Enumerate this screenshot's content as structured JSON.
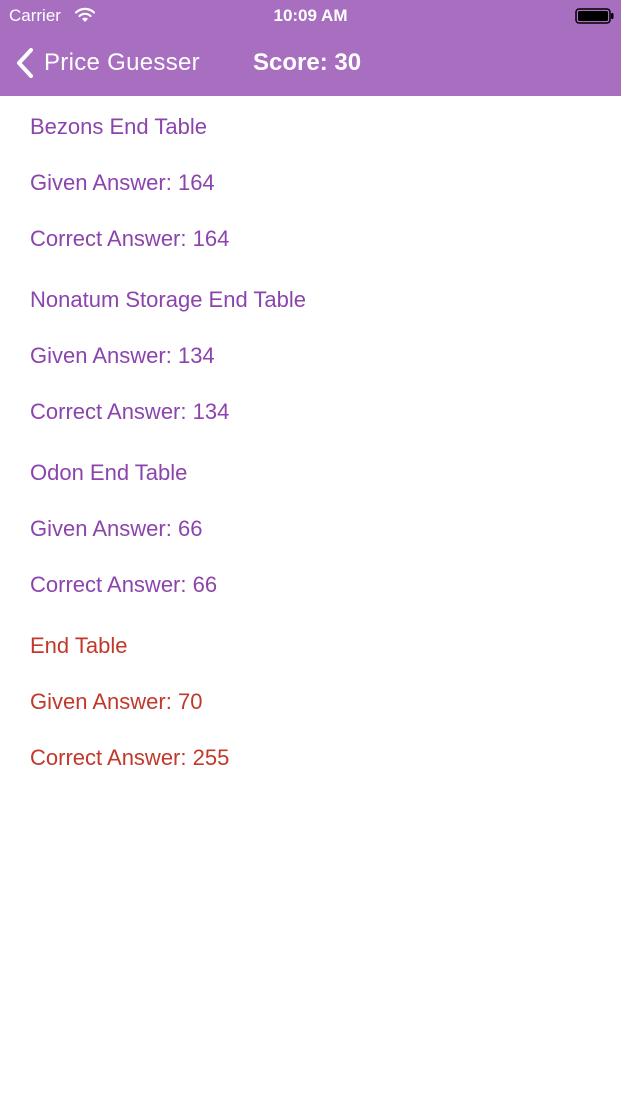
{
  "status_bar": {
    "carrier": "Carrier",
    "time": "10:09 AM",
    "wifi_icon": "wifi-icon",
    "battery_icon": "battery-icon"
  },
  "nav": {
    "back_label": "Price Guesser",
    "back_icon": "chevron-left-icon",
    "title": "Score: 30"
  },
  "colors": {
    "nav_background": "#a86fc0",
    "correct_text": "#8c44ad",
    "wrong_text": "#c0392b"
  },
  "results": [
    {
      "name": "Bezons End Table",
      "given": "Given Answer: 164",
      "correct": "Correct Answer: 164",
      "status": "correct"
    },
    {
      "name": "Nonatum Storage End Table",
      "given": "Given Answer: 134",
      "correct": "Correct Answer: 134",
      "status": "correct"
    },
    {
      "name": "Odon End Table",
      "given": "Given Answer: 66",
      "correct": "Correct Answer: 66",
      "status": "correct"
    },
    {
      "name": "End Table",
      "given": "Given Answer: 70",
      "correct": "Correct Answer: 255",
      "status": "wrong"
    }
  ]
}
